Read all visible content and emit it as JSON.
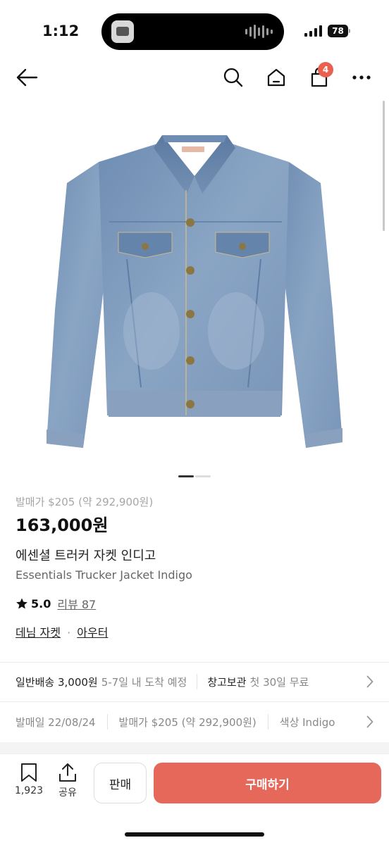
{
  "status_bar": {
    "time": "1:12",
    "battery": "78"
  },
  "nav": {
    "cart_count": "4",
    "icons": [
      "back-arrow-icon",
      "search-icon",
      "home-icon",
      "shopping-bag-icon",
      "more-icon"
    ]
  },
  "product": {
    "image_pages": 2,
    "active_page": 1,
    "release_line": "발매가 $205 (약 292,900원)",
    "price": "163,000원",
    "name_ko": "에센셜 트러커 자켓 인디고",
    "name_en": "Essentials Trucker Jacket Indigo",
    "rating": "5.0",
    "review_label": "리뷰 87",
    "categories": [
      "데님 자켓",
      "아우터"
    ],
    "category_separator": "·"
  },
  "shipping": {
    "standard_label": "일반배송 3,000원",
    "standard_eta": "5-7일 내 도착 예정",
    "warehouse_label": "창고보관",
    "warehouse_note": "첫 30일 무료"
  },
  "meta": {
    "release_date": "발매일 22/08/24",
    "release_price": "발매가 $205 (약 292,900원)",
    "color": "색상 Indigo"
  },
  "bottom_bar": {
    "bookmark_count": "1,923",
    "share_label": "공유",
    "sell_label": "판매",
    "buy_label": "구매하기"
  },
  "colors": {
    "accent": "#e5685a",
    "badge": "#e9604f",
    "denim": "#7f9bbd"
  }
}
